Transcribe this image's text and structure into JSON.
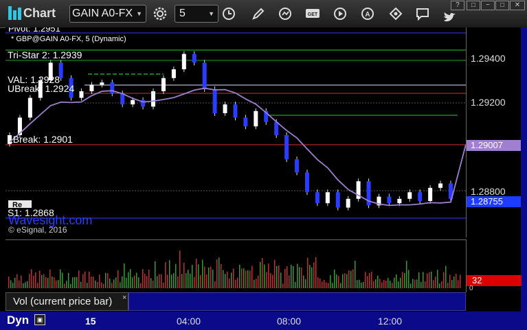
{
  "titlebar": {
    "app_title": "Chart",
    "symbol": "GAIN A0-FX",
    "interval": "5",
    "icons": [
      "settings-icon",
      "clock-icon",
      "pencil-icon",
      "refresh-icon",
      "get-icon",
      "play-icon",
      "auto-icon",
      "diamond-icon",
      "comment-icon",
      "twitter-icon"
    ],
    "window_buttons": [
      "?",
      "□",
      "−",
      "□",
      "✕"
    ]
  },
  "chart": {
    "header_top": "Pivot: 1.2951",
    "subtitle": "* GBP@GAIN A0-FX, 5 (Dynamic)",
    "watermark": "Wavesight.com",
    "copyright": "© eSignal, 2016",
    "button_label": "Re"
  },
  "levels": [
    {
      "label": "Tri-Star 2: 1.2939",
      "value": 1.2939,
      "color": "#2aa02a"
    },
    {
      "label": "VAL: 1.2928",
      "value": 1.2928,
      "color": "#e0e0ff"
    },
    {
      "label": "UBreak: 1.2924",
      "value": 1.2924,
      "color": "#e03030"
    },
    {
      "label": "LBreak: 1.2901",
      "value": 1.2901,
      "color": "#e03030"
    },
    {
      "label": "S1: 1.2868",
      "value": 1.2868,
      "color": "#3a3aff"
    }
  ],
  "price_axis": {
    "ticks": [
      "1.29400",
      "1.29200",
      "1.28800"
    ],
    "ma_tag": "1.29007",
    "ma_color": "#a07ed0",
    "last_tag": "1.28755",
    "last_color": "#1e3cff"
  },
  "volume": {
    "study_label": "Vol (current price bar)",
    "value_tag": "32",
    "extra": "0"
  },
  "time_axis": {
    "dyn_label": "Dyn",
    "labels": [
      "15",
      "04:00",
      "08:00",
      "12:00"
    ]
  },
  "colors": {
    "bar": "#2a3cff",
    "candle_up": "#ffffff",
    "candle_down": "#2a3cff",
    "moving_average": "#a07ed0",
    "vol_up": "#3a9a3a",
    "vol_down": "#c03030"
  },
  "chart_data": {
    "type": "candlestick",
    "title": "GBP@GAIN A0-FX, 5 (Dynamic)",
    "x_axis_labels": [
      "15",
      "04:00",
      "08:00",
      "12:00"
    ],
    "y_ticks": [
      1.294,
      1.292,
      1.288
    ],
    "last_price": 1.28755,
    "moving_average_last": 1.29007,
    "close_series": [
      1.2905,
      1.2913,
      1.2922,
      1.293,
      1.2938,
      1.2931,
      1.2922,
      1.2925,
      1.2928,
      1.2929,
      1.2924,
      1.2919,
      1.2921,
      1.2918,
      1.2925,
      1.2931,
      1.2935,
      1.2942,
      1.2938,
      1.2926,
      1.2915,
      1.2919,
      1.2913,
      1.2909,
      1.2916,
      1.2911,
      1.2905,
      1.2894,
      1.2888,
      1.2879,
      1.2874,
      1.2879,
      1.2872,
      1.2876,
      1.2884,
      1.2873,
      1.2877,
      1.2874,
      1.2876,
      1.2879,
      1.2875,
      1.2881,
      1.2883,
      1.2876
    ]
  }
}
